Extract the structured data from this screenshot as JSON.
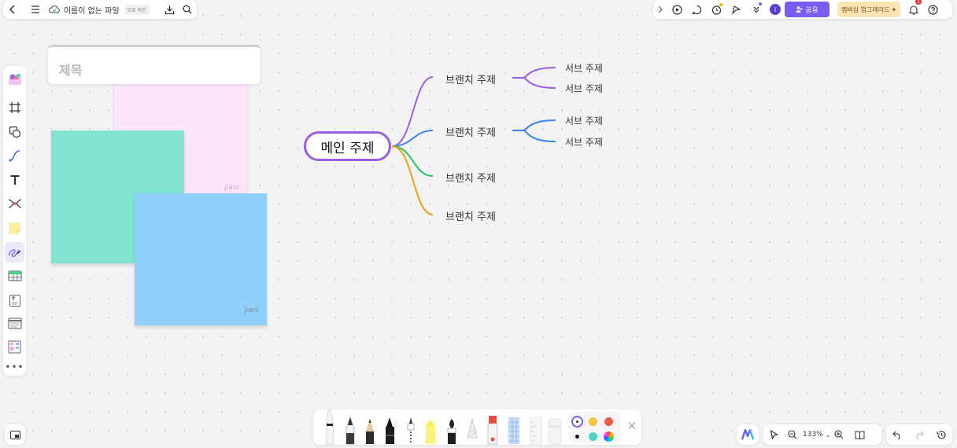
{
  "header": {
    "file_name": "이름이 없는 파일",
    "plan_badge": "무료 버전",
    "icons": [
      "back-icon",
      "menu-icon",
      "cloud-sync-icon",
      "download-icon",
      "search-icon"
    ]
  },
  "top_right": {
    "avatar_initial": "i",
    "share_label": "공유",
    "upgrade_label": "멤버십 업그레이드",
    "notification_count": "1",
    "icons": [
      "collapse-icon",
      "play-icon",
      "comment-icon",
      "timer-icon",
      "cursor-flag-icon",
      "more-icon",
      "person-icon",
      "bell-icon",
      "help-icon"
    ]
  },
  "left_toolbar": {
    "tools": [
      "template-tool",
      "frame-tool",
      "shape-tool",
      "connector-tool",
      "text-tool",
      "mindmap-tool",
      "sticky-note-tool",
      "pen-tool",
      "table-tool",
      "text-block-tool",
      "list-tool",
      "kanban-tool",
      "more-tools"
    ],
    "active": "pen-tool"
  },
  "canvas": {
    "title_card": "제목",
    "stickies": [
      {
        "color": "#fde6fd",
        "author": "jiani"
      },
      {
        "color": "#81e3d0",
        "author": ""
      },
      {
        "color": "#8fcffa",
        "author": "jiani"
      }
    ],
    "mindmap": {
      "main": "메인 주제",
      "branches": [
        {
          "label": "브랜치 주제",
          "color": "#9b5de5",
          "subs": [
            "서브 주제",
            "서브 주제"
          ]
        },
        {
          "label": "브랜치 주제",
          "color": "#3b82f6",
          "subs": [
            "서브 주제",
            "서브 주제"
          ]
        },
        {
          "label": "브랜치 주제",
          "color": "#22c55e",
          "subs": []
        },
        {
          "label": "브랜치 주제",
          "color": "#f59e0b",
          "subs": []
        }
      ]
    }
  },
  "bottom_toolbar": {
    "pens": [
      "fineliner",
      "fountain-pen",
      "pencil",
      "marker",
      "dotted-pen",
      "highlighter",
      "brush",
      "crayon",
      "red-marker",
      "grid-brush",
      "ruler",
      "eraser"
    ],
    "colors": [
      "#ffffff",
      "#f6c344",
      "#e85d4b",
      "#111111",
      "#4fcfc0",
      "rainbow"
    ],
    "close_label": "×"
  },
  "zoom": {
    "level": "133%"
  }
}
